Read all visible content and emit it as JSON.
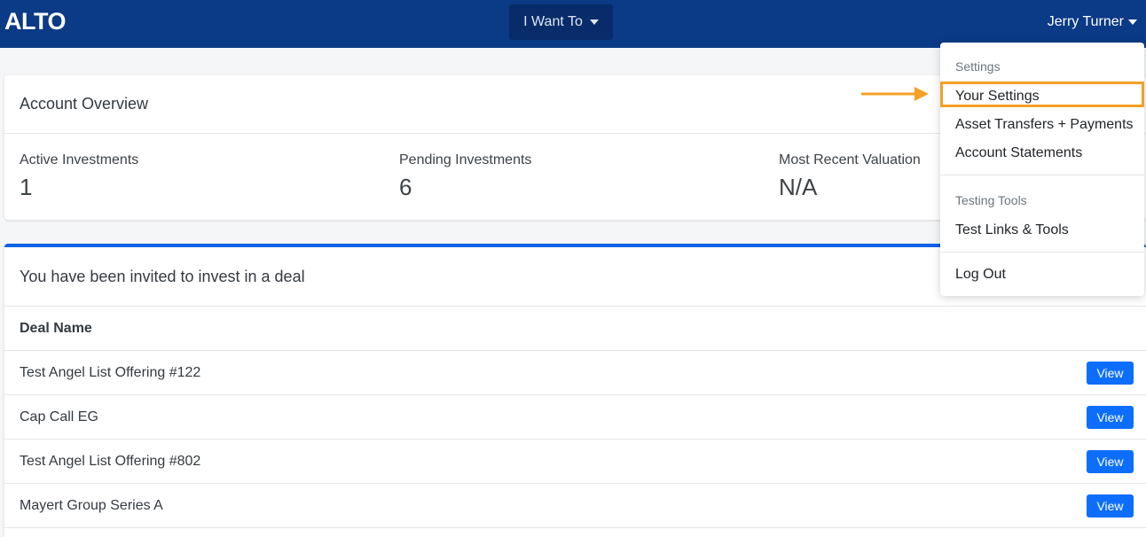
{
  "navbar": {
    "logo": "ALTO",
    "want_button": "I Want To",
    "user_name": "Jerry Turner"
  },
  "overview": {
    "title": "Account Overview",
    "stats": [
      {
        "label": "Active Investments",
        "value": "1"
      },
      {
        "label": "Pending Investments",
        "value": "6"
      },
      {
        "label": "Most Recent Valuation",
        "value": "N/A"
      }
    ]
  },
  "invites": {
    "title": "You have been invited to invest in a deal",
    "column_header": "Deal Name",
    "view_label": "View",
    "deals": [
      "Test Angel List Offering #122",
      "Cap Call EG",
      "Test Angel List Offering #802",
      "Mayert Group Series A"
    ]
  },
  "user_dropdown": {
    "settings_header": "Settings",
    "items": [
      "Your Settings",
      "Asset Transfers + Payments",
      "Account Statements"
    ],
    "testing_header": "Testing Tools",
    "testing_item": "Test Links & Tools",
    "logout": "Log Out"
  },
  "colors": {
    "navbar": "#0b3a86",
    "accent": "#0d6efd",
    "highlight": "#f5a025"
  }
}
